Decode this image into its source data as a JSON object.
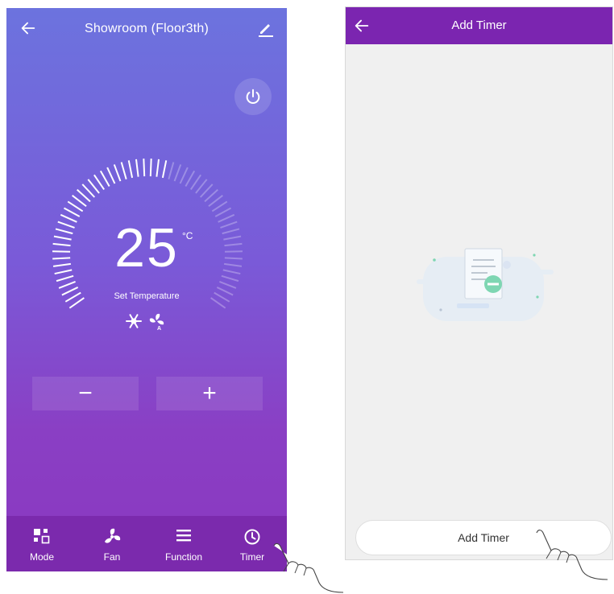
{
  "left_screen": {
    "header": {
      "title": "Showroom (Floor3th)"
    },
    "temperature": {
      "value": "25",
      "unit": "°C",
      "label": "Set Temperature"
    },
    "controls": {
      "decrease": "−",
      "increase": "+"
    },
    "tabs": [
      {
        "label": "Mode",
        "icon": "mode-icon"
      },
      {
        "label": "Fan",
        "icon": "fan-icon"
      },
      {
        "label": "Function",
        "icon": "menu-icon"
      },
      {
        "label": "Timer",
        "icon": "clock-icon"
      }
    ],
    "colors": {
      "gradient_top": "#6c73de",
      "gradient_bottom": "#8a38c0",
      "tabbar": "#7b2aad"
    }
  },
  "right_screen": {
    "header": {
      "title": "Add Timer"
    },
    "button": {
      "label": "Add Timer"
    },
    "colors": {
      "header": "#7b25b0",
      "background": "#f0f0f0"
    }
  }
}
